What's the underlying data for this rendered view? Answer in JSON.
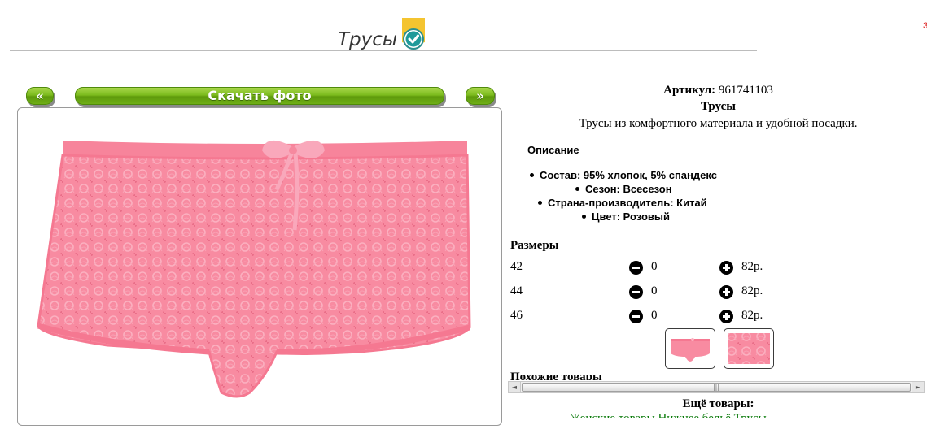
{
  "header": {
    "title": "Трусы",
    "badge_icon": "verified-check-icon",
    "accent_color": "#f4c430"
  },
  "nav": {
    "prev_label": "«",
    "download_label": "Скачать фото",
    "next_label": "»",
    "button_color": "#7cbb1e"
  },
  "product": {
    "article_label": "Артикул:",
    "article_value": "961741103",
    "name": "Трусы",
    "description": "Трусы из комфортного материала и удобной посадки.",
    "photo_color": "#f77f96"
  },
  "description_section": {
    "heading": "Описание",
    "specs": [
      "Состав: 95% хлопок, 5% спандекс",
      "Сезон: Всесезон",
      "Страна-производитель: Китай",
      "Цвет: Розовый"
    ]
  },
  "sizes": {
    "heading": "Размеры",
    "rows": [
      {
        "size": "42",
        "qty": "0",
        "price": "82р."
      },
      {
        "size": "44",
        "qty": "0",
        "price": "82р."
      },
      {
        "size": "46",
        "qty": "0",
        "price": "82р."
      }
    ]
  },
  "thumbnails": [
    {
      "alt": "panties-front-thumb"
    },
    {
      "alt": "lace-texture-thumb"
    }
  ],
  "similar": {
    "heading": "Похожие товары"
  },
  "scrollbar": {
    "left_arrow": "◄",
    "right_arrow": "►",
    "grip": "|||"
  },
  "more": {
    "heading": "Ещё товары:",
    "links": "Женские товары   Нижнее бельё   Трусы"
  }
}
